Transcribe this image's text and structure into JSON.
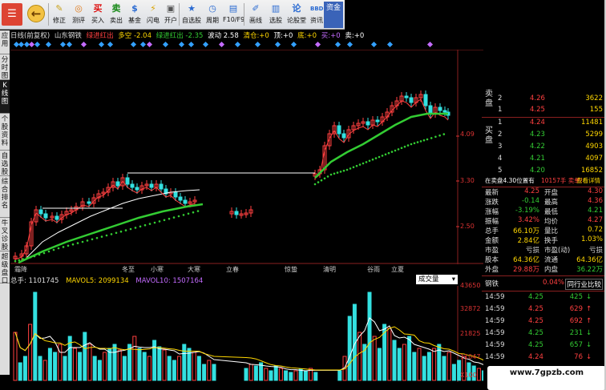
{
  "toolbar": {
    "items": [
      {
        "label": "修正",
        "icon": "edit-icon",
        "glyph": "✎",
        "color": "#c9a21b"
      },
      {
        "label": "测评",
        "icon": "evaluate-icon",
        "glyph": "◎",
        "color": "#e07b1a"
      },
      {
        "label": "买入",
        "icon": "buy-icon",
        "glyph": "买",
        "color": "#d11"
      },
      {
        "label": "卖出",
        "icon": "sell-icon",
        "glyph": "卖",
        "color": "#1a8a1a"
      },
      {
        "label": "基金",
        "icon": "fund-icon",
        "glyph": "$",
        "color": "#2a6ad1"
      },
      {
        "label": "闪电",
        "icon": "lightning-icon",
        "glyph": "⚡",
        "color": "#d9a300"
      },
      {
        "label": "开户",
        "icon": "account-icon",
        "glyph": "▣",
        "color": "#555"
      },
      {
        "label": "自选股",
        "icon": "watchlist-icon",
        "glyph": "★",
        "color": "#2a6ad1"
      },
      {
        "label": "周期",
        "icon": "period-icon",
        "glyph": "◷",
        "color": "#2a6ad1"
      },
      {
        "label": "F10/F9",
        "icon": "f10-icon",
        "glyph": "▤",
        "color": "#2a6ad1"
      },
      {
        "label": "画线",
        "icon": "draw-line-icon",
        "glyph": "✐",
        "color": "#2a6ad1"
      },
      {
        "label": "选股",
        "icon": "stock-picker-icon",
        "glyph": "▥",
        "color": "#2a6ad1"
      },
      {
        "label": "论股堂",
        "icon": "forum-icon",
        "glyph": "论",
        "color": "#2a6ad1"
      },
      {
        "label": "资讯",
        "icon": "news-icon",
        "glyph": "BBD",
        "color": "#2a6ad1"
      }
    ],
    "trade_label": "资金"
  },
  "left_tabs": [
    "应用",
    "分时图",
    "K线图",
    "个股资料",
    "自选股",
    "综合排名",
    "牛叉诊股",
    "超级盘口"
  ],
  "header": {
    "period": "日线(前复权)",
    "stock": "山东钢铁",
    "ind1": "绿进红出",
    "ind2": "多空 -2.04",
    "ind3": "绿进红出 -2.35",
    "ind4": "波动 2.58",
    "ind5": "清仓:+0",
    "ind6": "顶:+0",
    "ind7": "底:+0",
    "ind8": "买:+0",
    "ind9": "卖:+0"
  },
  "price_axis": [
    "4.09",
    "3.30",
    "2.50"
  ],
  "date_labels": [
    "霜降",
    "冬至",
    "小寒",
    "大寒",
    "立春",
    "惊蛰",
    "清明",
    "谷雨",
    "立夏"
  ],
  "volume": {
    "total": "总手: 1101745",
    "mavol5": "MAVOL5: 2099134",
    "mavol10": "MAVOL10: 1507164",
    "indicator": "成交量",
    "axis": [
      "43650",
      "32872",
      "21825",
      "11047",
      "X100"
    ]
  },
  "order_book": {
    "sell_label": "卖盘",
    "buy_label": "买盘",
    "sells": [
      {
        "level": "2",
        "price": "4.26",
        "vol": "3622"
      },
      {
        "level": "1",
        "price": "4.25",
        "vol": "155"
      }
    ],
    "buys": [
      {
        "level": "1",
        "price": "4.24",
        "vol": "11481"
      },
      {
        "level": "2",
        "price": "4.23",
        "vol": "5299"
      },
      {
        "level": "3",
        "price": "4.22",
        "vol": "4903"
      },
      {
        "level": "4",
        "price": "4.21",
        "vol": "4097"
      },
      {
        "level": "5",
        "price": "4.20",
        "vol": "16852"
      }
    ],
    "note": "在卖盘4.30位置有",
    "note2": "10157手 卖单!",
    "note_link": "查看详情"
  },
  "quote": [
    {
      "l1": "最新",
      "v1": "4.25",
      "c1": "#ff4040",
      "l2": "开盘",
      "v2": "4.30",
      "c2": "#ff4040"
    },
    {
      "l1": "涨跌",
      "v1": "-0.14",
      "c1": "#33cc33",
      "l2": "最高",
      "v2": "4.36",
      "c2": "#ff4040"
    },
    {
      "l1": "涨幅",
      "v1": "-3.19%",
      "c1": "#33cc33",
      "l2": "最低",
      "v2": "4.21",
      "c2": "#33cc33"
    },
    {
      "l1": "振幅",
      "v1": "3.42%",
      "c1": "#ff4040",
      "l2": "均价",
      "v2": "4.27",
      "c2": "#ff4040"
    },
    {
      "l1": "总手",
      "v1": "66.10万",
      "c1": "#ffd700",
      "l2": "量比",
      "v2": "0.72",
      "c2": "#ffd700"
    },
    {
      "l1": "金额",
      "v1": "2.84亿",
      "c1": "#ffd700",
      "l2": "换手",
      "v2": "1.03%",
      "c2": "#ffd700"
    },
    {
      "l1": "市盈",
      "v1": "亏损",
      "c1": "#ccc",
      "l2": "市盈(动)",
      "v2": "亏损",
      "c2": "#ccc"
    },
    {
      "l1": "股本",
      "v1": "64.36亿",
      "c1": "#ffd700",
      "l2": "流通",
      "v2": "64.36亿",
      "c2": "#ffd700"
    },
    {
      "l1": "外盘",
      "v1": "29.88万",
      "c1": "#ff4040",
      "l2": "内盘",
      "v2": "36.22万",
      "c2": "#33cc33"
    }
  ],
  "sector": {
    "name": "钢铁",
    "change": "0.04%",
    "compare": "同行业比较"
  },
  "ticks": [
    {
      "time": "14:59",
      "price": "4.25",
      "vol": "425",
      "dir": "↓",
      "color": "#33cc33"
    },
    {
      "time": "14:59",
      "price": "4.25",
      "vol": "629",
      "dir": "↑",
      "color": "#ff4040"
    },
    {
      "time": "14:59",
      "price": "4.25",
      "vol": "692",
      "dir": "↑",
      "color": "#ff4040"
    },
    {
      "time": "14:59",
      "price": "4.25",
      "vol": "231",
      "dir": "↓",
      "color": "#33cc33"
    },
    {
      "time": "14:59",
      "price": "4.25",
      "vol": "657",
      "dir": "↓",
      "color": "#33cc33"
    },
    {
      "time": "14:59",
      "price": "4.24",
      "vol": "76",
      "dir": "↓",
      "color": "#ff4040"
    }
  ],
  "watermark": "www.7gpzb.com"
}
